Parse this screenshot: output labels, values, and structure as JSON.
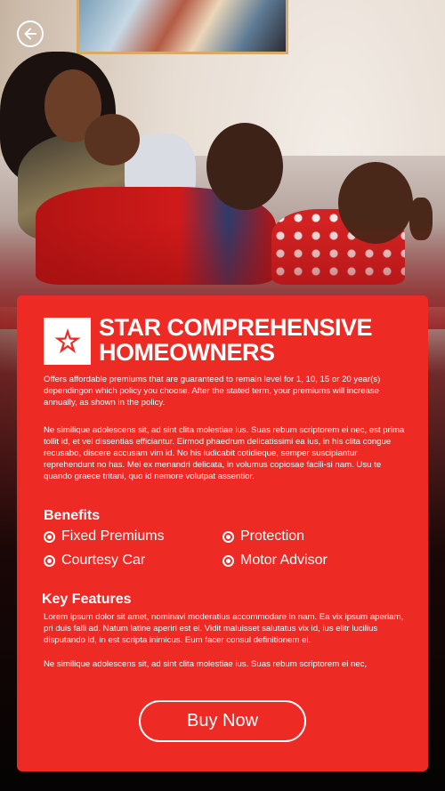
{
  "header": {
    "back_icon": "arrow-left-circle-icon"
  },
  "hero": {
    "image": "family-on-sofa-photo"
  },
  "card": {
    "logo_icon": "star-logo-icon",
    "title_line1": "STAR COMPREHENSIVE",
    "title_line2": "HOMEOWNERS",
    "intro": "Offers affordable premiums that are guaranteed to remain level for 1, 10, 15 or 20 year(s) dependingon which policy you choose. After the stated term, your premiums will increase annually, as shown in the policy.",
    "description": "Ne similique adolescens sit, ad sint clita molestiae ius. Suas rebum scriptorem ei nec, est prima tollit id, et vel dissentias efficiantur. Eirmod phaedrum delicatissimi ea ius, in his clita congue recusabo, discere accusam vim id. No his iudicabit cotidieque, semper suscipiantur reprehendunt no has. Mei ex menandri delicata, in volumus copiosae facili-si nam. Usu te quando graece tritani, quo id nemore volutpat assentior.",
    "benefits_heading": "Benefits",
    "benefits": [
      {
        "label": "Fixed Premiums"
      },
      {
        "label": "Protection"
      },
      {
        "label": "Courtesy Car"
      },
      {
        "label": "Motor Advisor"
      }
    ],
    "features_heading": "Key Features",
    "features_text1": "Lorem ipsum dolor sit amet, nominavi moderatius accommodare in nam. Ea vix ipsum aperiam, pri duis falli ad. Natum latine aperiri est ei. Vidit maluisset salutatus vix id, ius elitr lucilius disputando id, in est scripta inimicus. Eum facer consul definitionem ei.",
    "features_text2": "Ne similique adolescens sit, ad sint clita molestiae ius. Suas rebum scriptorem ei nec,",
    "buy_label": "Buy Now"
  },
  "colors": {
    "accent": "#ee2a24",
    "text": "#ffffff"
  }
}
